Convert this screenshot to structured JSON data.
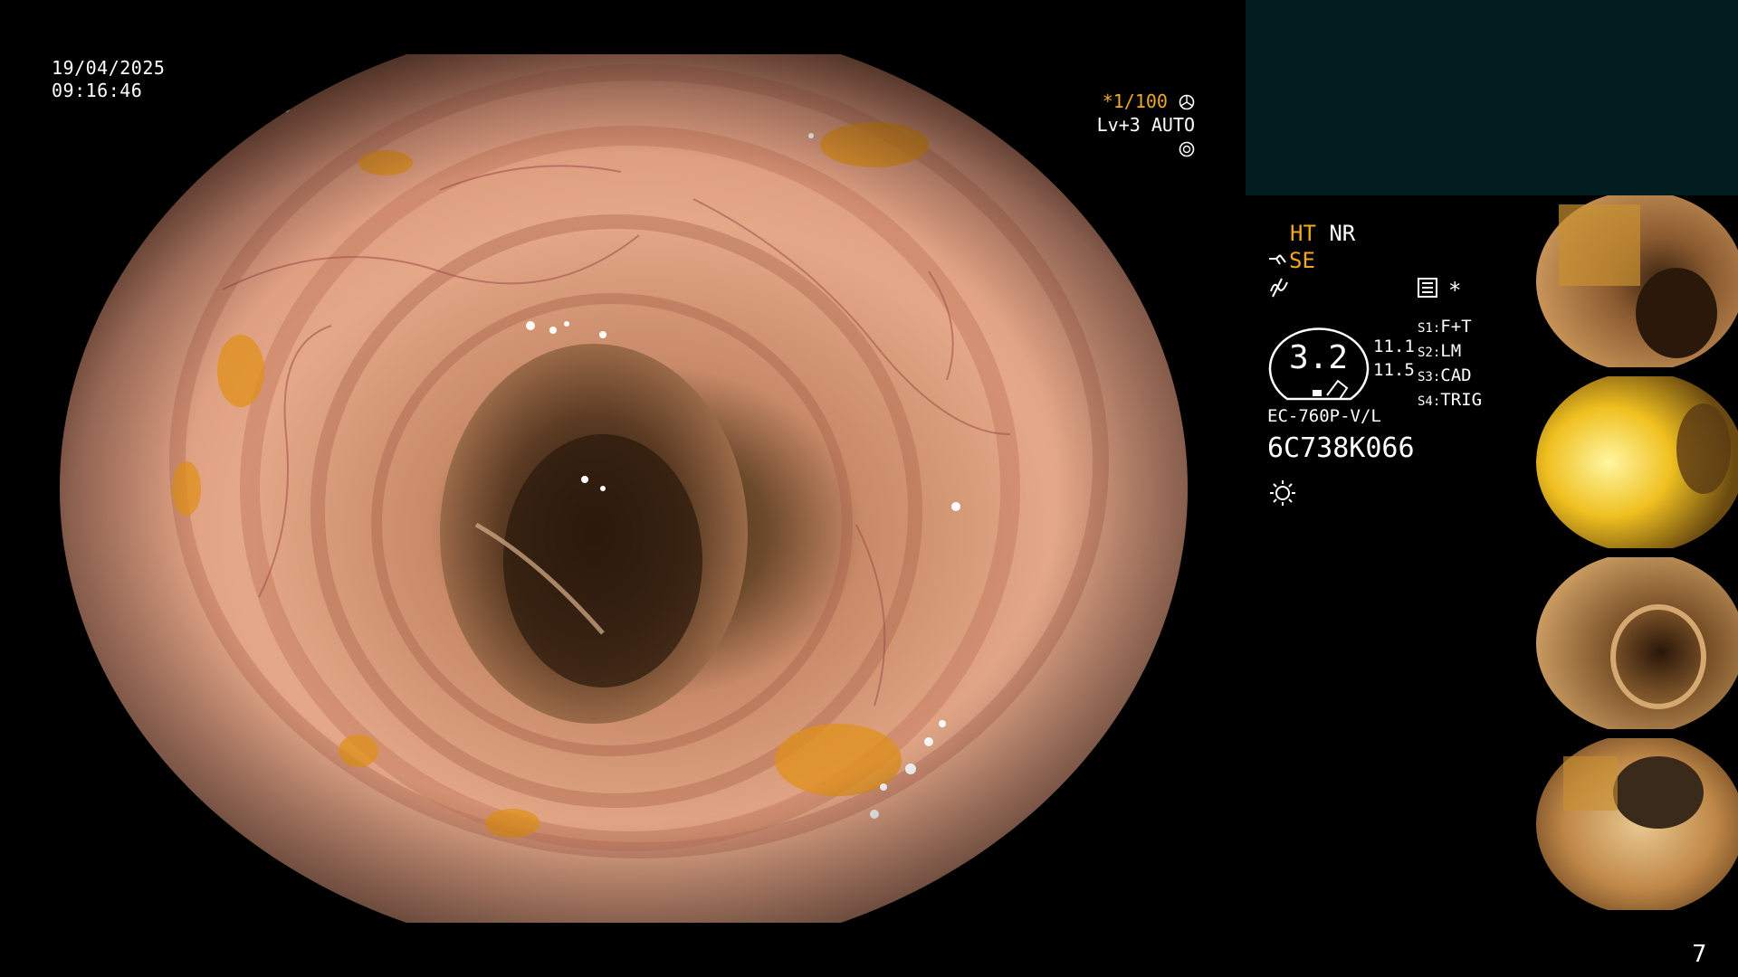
{
  "overlay": {
    "date": "19/04/2025",
    "time": "09:16:46",
    "shutter": "*1/100",
    "level": "Lv+3 AUTO"
  },
  "status": {
    "ht": "HT",
    "nr": "NR",
    "se": "SE",
    "gauge_value": "3.2",
    "val1": "11.1",
    "val2": "11.5",
    "star": "*",
    "s1_key": "S1:",
    "s1_val": "F+T",
    "s2_key": "S2:",
    "s2_val": "LM",
    "s3_key": "S3:",
    "s3_val": "CAD",
    "s4_key": "S4:",
    "s4_val": "TRIG",
    "scope_model": "EC-760P-V/L",
    "serial": "6C738K066"
  },
  "page_number": "7",
  "colors": {
    "accent_orange": "#f0a820",
    "panel_teal": "#021d1f",
    "background": "#000000"
  },
  "icons": [
    "shutter-icon",
    "auto-iris-icon",
    "scope-icon",
    "flash-icon",
    "image-mode-icon",
    "light-sun-icon",
    "gauge-icon"
  ]
}
